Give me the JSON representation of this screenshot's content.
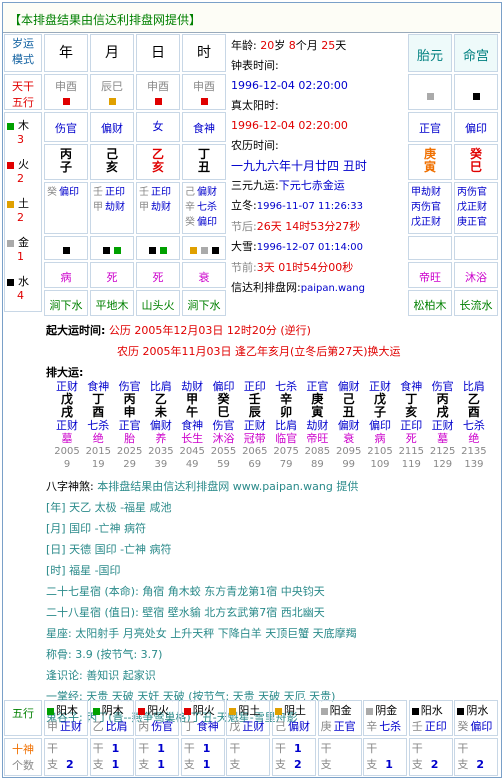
{
  "header": "【本排盘结果由信达利排盘网提供】",
  "left_col": {
    "mode1": "岁运",
    "mode2": "模式",
    "tg": "天干",
    "wx": "五行",
    "elements": [
      {
        "name": "木",
        "count": "3",
        "color": "#00a000"
      },
      {
        "name": "火",
        "count": "2",
        "color": "#e00000"
      },
      {
        "name": "土",
        "count": "2",
        "color": "#e0a000"
      },
      {
        "name": "金",
        "count": "1",
        "color": "#aaaaaa"
      },
      {
        "name": "水",
        "count": "4",
        "color": "#000000"
      }
    ]
  },
  "pillars": [
    {
      "label": "年",
      "col": "申酉",
      "col_sq": "#e00000",
      "shishen": "伤官",
      "gan": "丙",
      "zhi": "子",
      "hidden": [
        [
          "癸",
          "偏印"
        ]
      ],
      "sq": [
        "#000000"
      ],
      "xiu": "病",
      "nayin": "涧下水"
    },
    {
      "label": "月",
      "col": "辰巳",
      "col_sq": "#e0a000",
      "shishen": "偏财",
      "gan": "己",
      "zhi": "亥",
      "hidden": [
        [
          "壬",
          "正印"
        ],
        [
          "甲",
          "劫财"
        ]
      ],
      "sq": [
        "#000000",
        "#00a000"
      ],
      "xiu": "死",
      "nayin": "平地木"
    },
    {
      "label": "日",
      "col": "申酉",
      "col_sq": "#e00000",
      "shishen": "女",
      "gan": "乙",
      "zhi": "亥",
      "hidden": [
        [
          "壬",
          "正印"
        ],
        [
          "甲",
          "劫财"
        ]
      ],
      "sq": [
        "#000000",
        "#00a000"
      ],
      "xiu": "死",
      "nayin": "山头火"
    },
    {
      "label": "时",
      "col": "申酉",
      "col_sq": "#e00000",
      "shishen": "食神",
      "gan": "丁",
      "zhi": "丑",
      "hidden": [
        [
          "己",
          "偏财"
        ],
        [
          "辛",
          "七杀"
        ],
        [
          "癸",
          "偏印"
        ]
      ],
      "sq": [
        "#e0a000",
        "#aaaaaa",
        "#000000"
      ],
      "xiu": "衰",
      "nayin": "涧下水"
    }
  ],
  "info": {
    "age_l": "年龄:",
    "age": "20",
    "sui": "岁",
    "month": "8",
    "yue": "个月",
    "day": "25",
    "tian": "天",
    "clock_l": "钟表时间:",
    "clock": "1996-12-04 02:20:00",
    "true_l": "真太阳时:",
    "true": "1996-12-04 02:20:00",
    "lunar_l": "农历时间:",
    "lunar": "一九九六年十月廿四 丑时",
    "sanyuan_l": "三元九运:",
    "sanyuan": "下元七赤金运",
    "lidong_l": "立冬:",
    "lidong": "1996-11-07 11:26:33",
    "after_l": "节后:",
    "after": "26天 14时53分27秒",
    "daxue_l": "大雪:",
    "daxue": "1996-12-07 01:14:00",
    "before_l": "节前:",
    "before": "3天 01时54分00秒",
    "site_l": "信达利排盘网:",
    "site": "paipan.wang"
  },
  "taiyuan": {
    "title": "胎元",
    "ss": "正官",
    "gz": "庚寅",
    "hidden": "甲劫财 丙伤官 戊正财",
    "xiu": "帝旺",
    "nayin": "松柏木"
  },
  "minggong": {
    "title": "命宫",
    "ss": "偏印",
    "gz": "癸巳",
    "hidden": "丙伤官 戊正财 庚正官",
    "xiu": "沐浴",
    "nayin": "长流水"
  },
  "qiyun": {
    "l1": "起大运时间:",
    "t1": "公历 2005年12月03日 12时20分 (逆行)",
    "t2": "农历 2005年11月03日 逢乙年亥月(立冬后第27天)换大运"
  },
  "dayun": {
    "label": "排大运:",
    "items": [
      [
        "正财",
        "戊",
        "戌",
        "正财",
        "墓",
        "2005",
        "9"
      ],
      [
        "食神",
        "丁",
        "酉",
        "七杀",
        "绝",
        "2015",
        "19"
      ],
      [
        "伤官",
        "丙",
        "申",
        "正官",
        "胎",
        "2025",
        "29"
      ],
      [
        "比肩",
        "乙",
        "未",
        "偏财",
        "养",
        "2035",
        "39"
      ],
      [
        "劫财",
        "甲",
        "午",
        "食神",
        "长生",
        "2045",
        "49"
      ],
      [
        "偏印",
        "癸",
        "巳",
        "伤官",
        "沐浴",
        "2055",
        "59"
      ],
      [
        "正印",
        "壬",
        "辰",
        "正财",
        "冠带",
        "2065",
        "69"
      ],
      [
        "七杀",
        "辛",
        "卯",
        "比肩",
        "临官",
        "2075",
        "79"
      ],
      [
        "正官",
        "庚",
        "寅",
        "劫财",
        "帝旺",
        "2085",
        "89"
      ],
      [
        "偏财",
        "己",
        "丑",
        "偏财",
        "衰",
        "2095",
        "99"
      ],
      [
        "正财",
        "戊",
        "子",
        "偏印",
        "病",
        "2105",
        "109"
      ],
      [
        "食神",
        "丁",
        "亥",
        "正印",
        "死",
        "2115",
        "119"
      ],
      [
        "伤官",
        "丙",
        "戌",
        "正财",
        "墓",
        "2125",
        "129"
      ],
      [
        "比肩",
        "乙",
        "酉",
        "七杀",
        "绝",
        "2135",
        "139"
      ]
    ]
  },
  "shensha": {
    "label": "八字神煞:",
    "note": "本排盘结果由信达利排盘网 www.paipan.wang 提供",
    "year": "[年] 天乙 太极 -福星 咸池",
    "month": "[月] 国印 -亡神 病符",
    "day": "[日] 天德 国印 -亡神 病符",
    "hour": "[时] 福星 -国印"
  },
  "stars": {
    "s28a": "二十七星宿 (本命): 角宿 角木蛟 东方青龙第1宿 中央钧天",
    "s28b": "二十八星宿 (值日): 壁宿 壁水貐 北方玄武第7宿 西北幽天",
    "zodiac": "星座: 太阳射手 月亮处女 上升天秤 下降白羊 天顶巨蟹 天底摩羯",
    "weight": "称骨: 3.9 (按节气: 3.7)",
    "fate": "逢识论: 善知识 起家识",
    "yizhang": "一掌经: 天贵 天破 天奸 天破 (按节气: 天贵 天破 天厄 天贵)",
    "guigu": "鬼谷子: 丙丁(晋--燕争莺巢格)丁丑-天魁星-雪里舟影"
  },
  "bottom": {
    "c1": "五行",
    "c2": "十神",
    "c3": "个数",
    "cols": [
      [
        "阳木",
        "甲",
        "正财",
        "",
        "2",
        "#00a000"
      ],
      [
        "阴木",
        "乙",
        "比肩",
        "1",
        "1",
        "#00a000"
      ],
      [
        "阳火",
        "丙",
        "伤官",
        "1",
        "1",
        "#e00000"
      ],
      [
        "阴火",
        "丁",
        "食神",
        "1",
        "1",
        "#e00000"
      ],
      [
        "阳土",
        "戊",
        "正财",
        "",
        "",
        " #e0a000"
      ],
      [
        "阴土",
        "己",
        "偏财",
        "1",
        "2",
        "#e0a000"
      ],
      [
        "阳金",
        "庚",
        "正官",
        "",
        "",
        "#aaaaaa"
      ],
      [
        "阴金",
        "辛",
        "七杀",
        "",
        "1",
        "#aaaaaa"
      ],
      [
        "阳水",
        "壬",
        "正印",
        "",
        "2",
        "#000000"
      ],
      [
        "阴水",
        "癸",
        "偏印",
        "",
        "2",
        "#000000"
      ]
    ]
  }
}
